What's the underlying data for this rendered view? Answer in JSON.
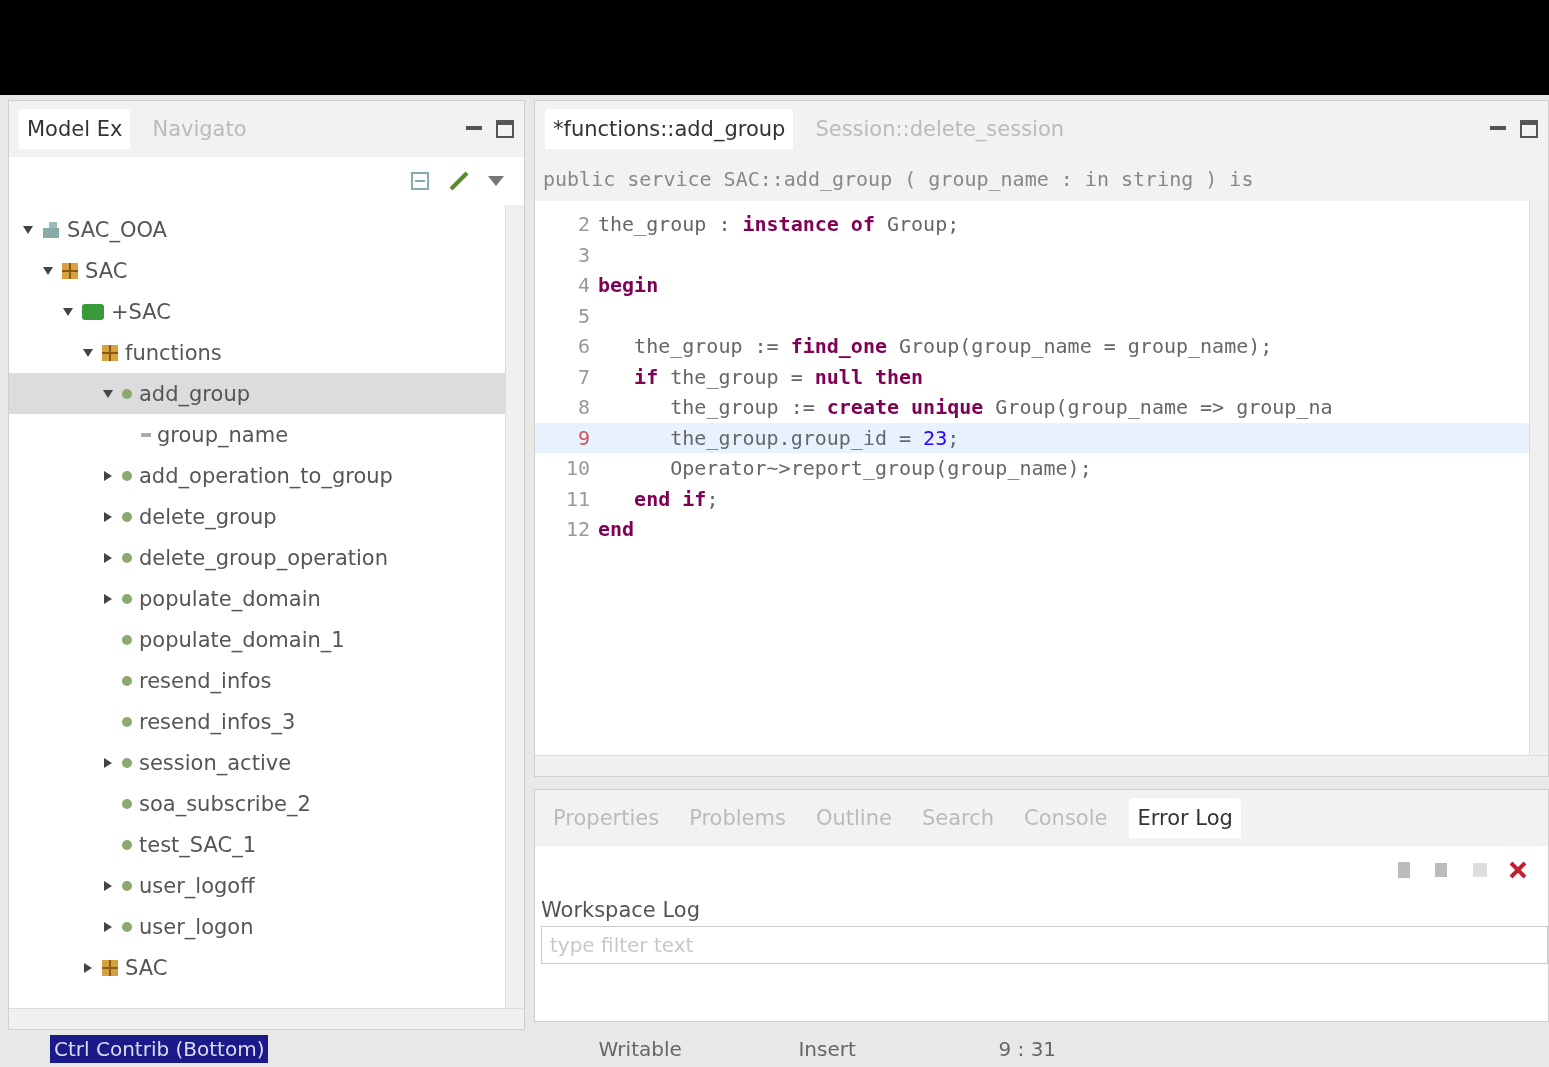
{
  "left_panel": {
    "tabs": [
      {
        "label": "Model Ex",
        "selected": true
      },
      {
        "label": "Navigato",
        "selected": false
      }
    ],
    "tree": [
      {
        "label": "SAC_OOA",
        "kind": "project",
        "expanded": true,
        "selected": false,
        "children": [
          {
            "label": "SAC",
            "kind": "package",
            "expanded": true,
            "selected": false,
            "children": [
              {
                "label": "+SAC",
                "kind": "component",
                "expanded": true,
                "selected": false,
                "children": [
                  {
                    "label": "functions",
                    "kind": "package",
                    "expanded": true,
                    "selected": false,
                    "children": [
                      {
                        "label": "add_group",
                        "kind": "function",
                        "expanded": true,
                        "selected": true,
                        "children": [
                          {
                            "label": "group_name",
                            "kind": "parameter",
                            "selected": false
                          }
                        ]
                      },
                      {
                        "label": "add_operation_to_group",
                        "kind": "function",
                        "expanded": false,
                        "selected": false
                      },
                      {
                        "label": "delete_group",
                        "kind": "function",
                        "expanded": false,
                        "selected": false
                      },
                      {
                        "label": "delete_group_operation",
                        "kind": "function",
                        "expanded": false,
                        "selected": false
                      },
                      {
                        "label": "populate_domain",
                        "kind": "function",
                        "expanded": false,
                        "selected": false
                      },
                      {
                        "label": "populate_domain_1",
                        "kind": "function",
                        "selected": false
                      },
                      {
                        "label": "resend_infos",
                        "kind": "function",
                        "selected": false
                      },
                      {
                        "label": "resend_infos_3",
                        "kind": "function",
                        "selected": false
                      },
                      {
                        "label": "session_active",
                        "kind": "function",
                        "expanded": false,
                        "selected": false
                      },
                      {
                        "label": "soa_subscribe_2",
                        "kind": "function",
                        "selected": false
                      },
                      {
                        "label": "test_SAC_1",
                        "kind": "function",
                        "selected": false
                      },
                      {
                        "label": "user_logoff",
                        "kind": "function",
                        "expanded": false,
                        "selected": false
                      },
                      {
                        "label": "user_logon",
                        "kind": "function",
                        "expanded": false,
                        "selected": false
                      }
                    ]
                  },
                  {
                    "label": "SAC",
                    "kind": "package",
                    "expanded": false,
                    "selected": false
                  }
                ]
              }
            ]
          }
        ]
      }
    ]
  },
  "editor": {
    "tabs": [
      {
        "label": "*functions::add_group",
        "selected": true
      },
      {
        "label": "Session::delete_session",
        "selected": false
      }
    ],
    "header": "public service SAC::add_group ( group_name : in string ) is",
    "lines": [
      {
        "number": "2",
        "current": false,
        "tokens": [
          {
            "text": "the_group : ",
            "kind": "plain"
          },
          {
            "text": "instance of",
            "kind": "keyword"
          },
          {
            "text": " Group;",
            "kind": "plain"
          }
        ]
      },
      {
        "number": "3",
        "current": false
      },
      {
        "number": "4",
        "current": false,
        "tokens": [
          {
            "text": "begin",
            "kind": "keyword"
          }
        ]
      },
      {
        "number": "5",
        "current": false
      },
      {
        "number": "6",
        "current": false,
        "tokens": [
          {
            "text": "   the_group := ",
            "kind": "plain"
          },
          {
            "text": "find_one",
            "kind": "keyword"
          },
          {
            "text": " Group(group_name = group_name);",
            "kind": "plain"
          }
        ]
      },
      {
        "number": "7",
        "current": false,
        "tokens": [
          {
            "text": "   if",
            "kind": "keyword"
          },
          {
            "text": " the_group = ",
            "kind": "plain"
          },
          {
            "text": "null then",
            "kind": "keyword"
          }
        ]
      },
      {
        "number": "8",
        "current": false,
        "tokens": [
          {
            "text": "      the_group := ",
            "kind": "plain"
          },
          {
            "text": "create unique",
            "kind": "keyword"
          },
          {
            "text": " Group(group_name => group_na",
            "kind": "plain"
          }
        ]
      },
      {
        "number": "9",
        "current": true,
        "tokens": [
          {
            "text": "      the_group.group_id = ",
            "kind": "plain"
          },
          {
            "text": "23",
            "kind": "number"
          },
          {
            "text": ";",
            "kind": "plain"
          }
        ]
      },
      {
        "number": "10",
        "current": false,
        "tokens": [
          {
            "text": "      Operator~>report_group(group_name);",
            "kind": "plain"
          }
        ]
      },
      {
        "number": "11",
        "current": false,
        "tokens": [
          {
            "text": "   end if",
            "kind": "keyword"
          },
          {
            "text": ";",
            "kind": "plain"
          }
        ]
      },
      {
        "number": "12",
        "current": false,
        "tokens": [
          {
            "text": "end",
            "kind": "keyword"
          }
        ]
      }
    ]
  },
  "bottom_panel": {
    "tabs": [
      {
        "label": "Properties",
        "selected": false
      },
      {
        "label": "Problems",
        "selected": false
      },
      {
        "label": "Outline",
        "selected": false
      },
      {
        "label": "Search",
        "selected": false
      },
      {
        "label": "Console",
        "selected": false
      },
      {
        "label": "Error Log",
        "selected": true
      }
    ],
    "log_title": "Workspace Log",
    "filter": {
      "placeholder": "type filter text"
    }
  },
  "status_bar": {
    "contribution": "Ctrl Contrib (Bottom)",
    "mode": "Writable",
    "insert": "Insert",
    "position": "9 : 31"
  }
}
